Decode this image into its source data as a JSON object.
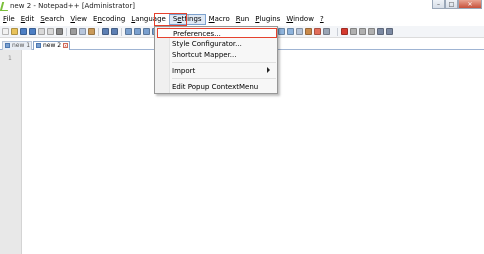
{
  "window": {
    "title": "new 2 - Notepad++ [Administrator]",
    "icon": "notepadpp-icon",
    "controls": [
      "minimize-icon",
      "maximize-icon",
      "close-icon"
    ],
    "control_glyphs": {
      "minimize": "–",
      "maximize": "□",
      "close": "✕"
    }
  },
  "menubar": {
    "items": [
      {
        "label": "File",
        "mnemonic_index": 0
      },
      {
        "label": "Edit",
        "mnemonic_index": 0
      },
      {
        "label": "Search",
        "mnemonic_index": 0
      },
      {
        "label": "View",
        "mnemonic_index": 0
      },
      {
        "label": "Encoding",
        "mnemonic_index": 1
      },
      {
        "label": "Language",
        "mnemonic_index": 0
      },
      {
        "label": "Settings",
        "mnemonic_index": 1,
        "active": true
      },
      {
        "label": "Macro",
        "mnemonic_index": 0
      },
      {
        "label": "Run",
        "mnemonic_index": 0
      },
      {
        "label": "Plugins",
        "mnemonic_index": 0
      },
      {
        "label": "Window",
        "mnemonic_index": 0
      },
      {
        "label": "?",
        "mnemonic_index": 0
      }
    ],
    "highlight_color": "#e5412d"
  },
  "tabs": [
    {
      "label": "new 1",
      "active": false
    },
    {
      "label": "new 2",
      "active": true,
      "close_glyph": "x"
    }
  ],
  "editor": {
    "line_numbers": [
      "1"
    ]
  },
  "settings_menu": {
    "items": [
      {
        "label": "Preferences...",
        "highlighted": true
      },
      {
        "label": "Style Configurator..."
      },
      {
        "label": "Shortcut Mapper..."
      },
      {
        "label": "Import",
        "submenu": true
      },
      {
        "label": "Edit Popup ContextMenu"
      }
    ]
  }
}
